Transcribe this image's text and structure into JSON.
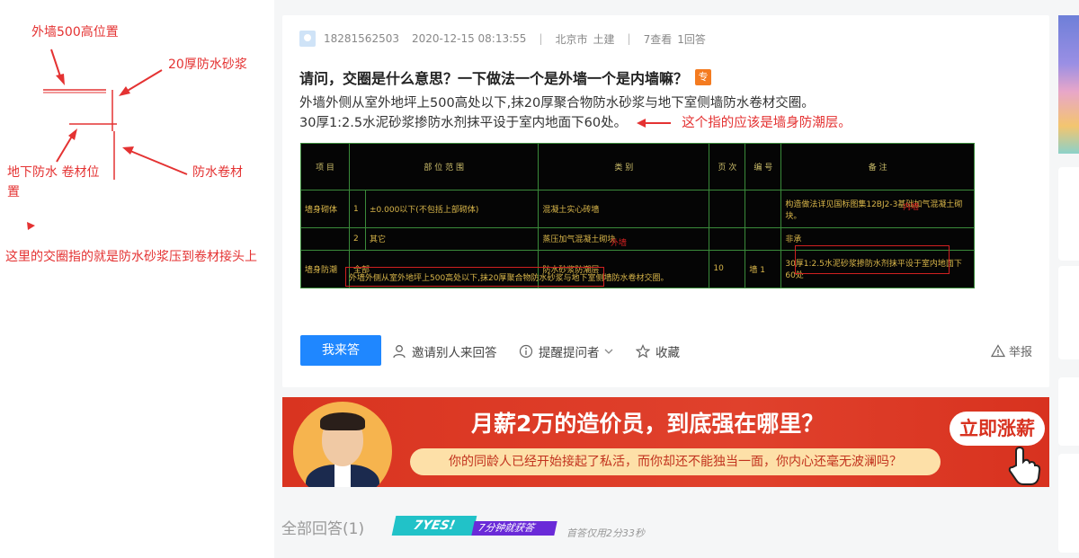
{
  "annotation": {
    "label_outer_wall": "外墙500高位置",
    "label_mortar": "20厚防水砂浆",
    "label_underground": "地下防水 卷材位置",
    "label_membrane": "防水卷材",
    "label_conclusion": "这里的交圈指的就是防水砂浆压到卷材接头上",
    "color_red": "#e43232"
  },
  "question": {
    "username": "18281562503",
    "datetime": "2020-12-15 08:13:55",
    "location": "北京市",
    "category": "土建",
    "views": "7查看",
    "answers_count": "1回答",
    "title": "请问，交圈是什么意思？一下做法一个是外墙一个是内墙嘛？",
    "badge": "专",
    "desc_line1": "外墙外侧从室外地坪上500高处以下,抹20厚聚合物防水砂浆与地下室侧墙防水卷材交圈。",
    "desc_line2": "30厚1:2.5水泥砂浆掺防水剂抹平设于室内地面下60处。",
    "desc_note": "这个指的应该是墙身防潮层。"
  },
  "drawing": {
    "headers": [
      "项 目",
      "部 位 范 围",
      "类 别",
      "页 次",
      "编 号",
      "备 注"
    ],
    "rows": [
      [
        "墙身砌体",
        "1",
        "±0.000以下(不包括上部砌体)",
        "混凝土实心砖墙",
        "",
        "",
        "构造做法详见国标图集12BJ2-3基础加气混凝土砌块。"
      ],
      [
        "",
        "2",
        "其它",
        "蒸压加气混凝土砌块",
        "",
        "",
        "非承"
      ],
      [
        "墙身防潮",
        "全部",
        "",
        "防水砂浆防潮层",
        "10",
        "墙 1",
        "30厚1:2.5水泥砂浆掺防水剂抹平设于室内地面下60处"
      ]
    ],
    "bottom_text": "外墙外侧从室外地坪上500高处以下,抹20厚聚合物防水砂浆与地下室侧墙防水卷材交圈。",
    "note_outer": "外墙",
    "note_inner": "内墙"
  },
  "actions": {
    "answer_button": "我来答",
    "invite": "邀请别人来回答",
    "remind": "提醒提问者",
    "collect": "收藏",
    "report": "举报"
  },
  "banner": {
    "headline": "月薪2万的造价员，到底强在哪里？",
    "subline": "你的同龄人已经开始接起了私活，而你却还不能独当一面，你内心还毫无波澜吗？",
    "cta": "立即涨薪"
  },
  "answers": {
    "title": "全部回答(1)",
    "yes_main": "7YES!",
    "yes_side": "7分钟就获答",
    "first_answer_note": "首答仅用2分33秒"
  }
}
